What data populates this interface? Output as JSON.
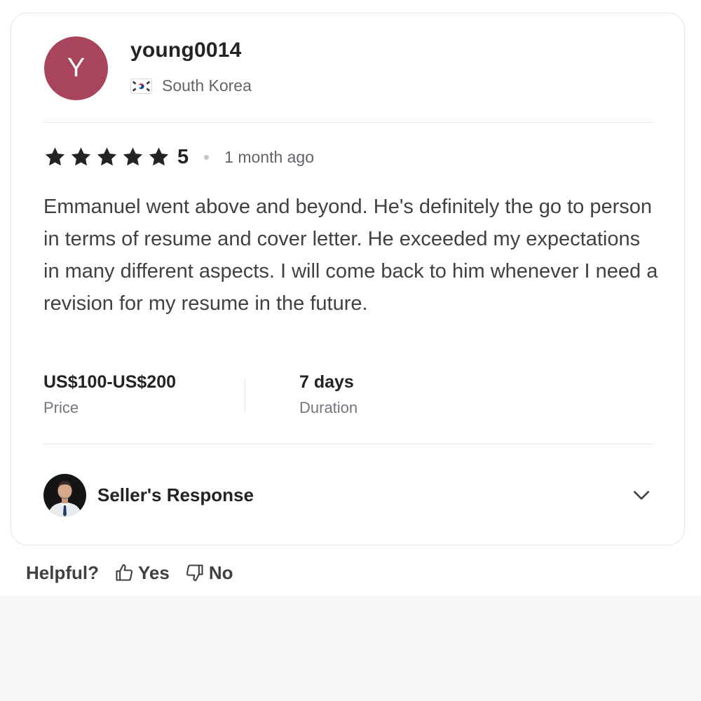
{
  "review": {
    "avatar_initial": "Y",
    "avatar_color": "#a8455d",
    "username": "young0014",
    "country": "South Korea",
    "country_flag_icon": "south-korea-flag-icon",
    "rating": 5,
    "rating_text": "5",
    "time_ago": "1 month ago",
    "text": "Emmanuel went above and beyond. He's definitely the go to person in terms of resume and cover letter. He exceeded my expectations in many different aspects. I will come back to him whenever I need a revision for my resume in the future.",
    "price_value": "US$100-US$200",
    "price_label": "Price",
    "duration_value": "7 days",
    "duration_label": "Duration",
    "seller_response_label": "Seller's Response"
  },
  "helpful": {
    "label": "Helpful?",
    "yes_label": "Yes",
    "no_label": "No"
  },
  "colors": {
    "star": "#222325",
    "text_primary": "#222325",
    "text_secondary": "#62646a",
    "border": "#e4e5e7",
    "page_bottom": "#f7f7f9"
  }
}
